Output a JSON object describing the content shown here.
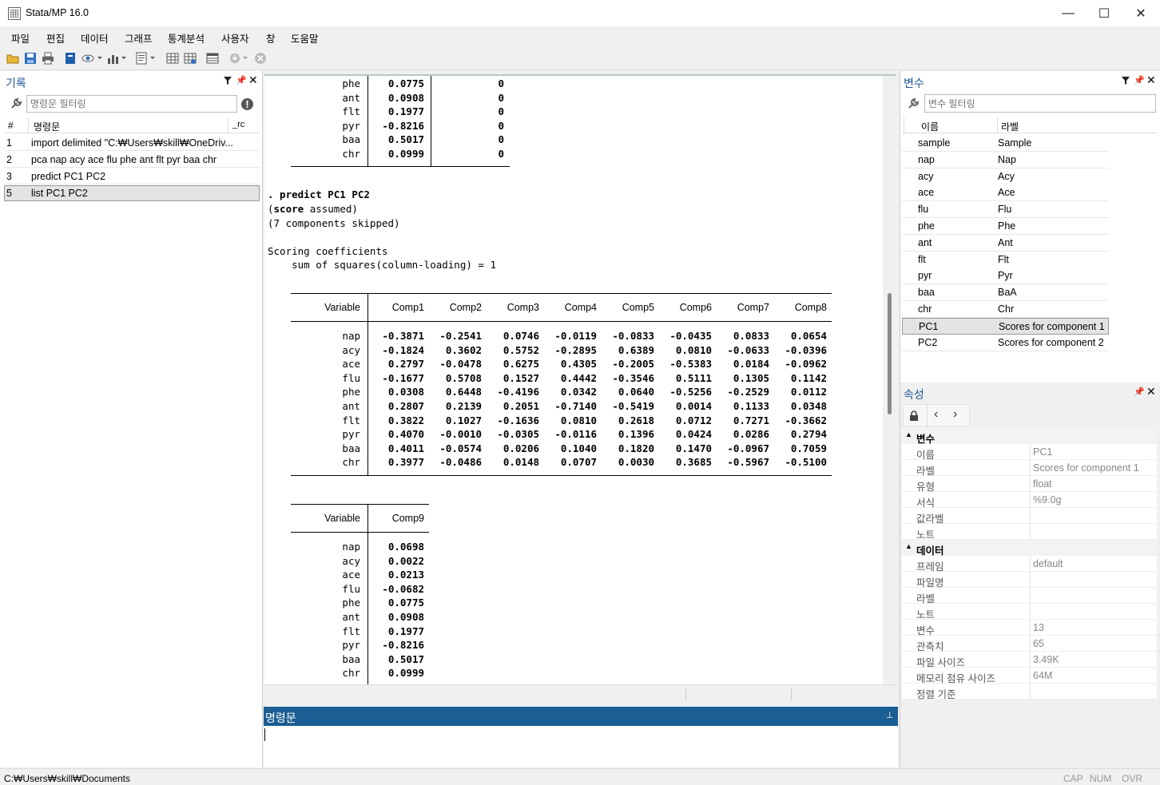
{
  "window": {
    "title": "Stata/MP 16.0",
    "minimize": "—",
    "maximize": "☐",
    "close": "✕"
  },
  "menu": [
    "파일",
    "편집",
    "데이터",
    "그래프",
    "통계분석",
    "사용자",
    "창",
    "도움말"
  ],
  "history": {
    "title": "기록",
    "filter_placeholder": "명령문 필터링",
    "col_num": "#",
    "col_cmd": "명령문",
    "col_rc": "_rc",
    "rows": [
      {
        "num": "1",
        "cmd": "import delimited \"C:₩Users₩skill₩OneDriv..."
      },
      {
        "num": "2",
        "cmd": "pca nap acy ace flu phe ant flt pyr baa chr"
      },
      {
        "num": "3",
        "cmd": "predict PC1 PC2"
      },
      {
        "num": "5",
        "cmd": "list PC1 PC2"
      }
    ]
  },
  "results": {
    "top_rows": [
      {
        "v": "phe",
        "a": "0.0775",
        "b": "0"
      },
      {
        "v": "ant",
        "a": "0.0908",
        "b": "0"
      },
      {
        "v": "flt",
        "a": "0.1977",
        "b": "0"
      },
      {
        "v": "pyr",
        "a": "-0.8216",
        "b": "0"
      },
      {
        "v": "baa",
        "a": "0.5017",
        "b": "0"
      },
      {
        "v": "chr",
        "a": "0.0999",
        "b": "0"
      }
    ],
    "cmd_line": ". predict PC1 PC2",
    "score_open": "(",
    "score_word": "score",
    "score_rest": " assumed)",
    "skipped": "(7 components skipped)",
    "scoring": "Scoring coefficients",
    "sumsq": "    sum of squares(column-loading) = 1",
    "table1_header": [
      "Variable",
      "Comp1",
      "Comp2",
      "Comp3",
      "Comp4",
      "Comp5",
      "Comp6",
      "Comp7",
      "Comp8"
    ],
    "table1_rows": [
      [
        "nap",
        "-0.3871",
        "-0.2541",
        "0.0746",
        "-0.0119",
        "-0.0833",
        "-0.0435",
        "0.0833",
        "0.0654"
      ],
      [
        "acy",
        "-0.1824",
        "0.3602",
        "0.5752",
        "-0.2895",
        "0.6389",
        "0.0810",
        "-0.0633",
        "-0.0396"
      ],
      [
        "ace",
        "0.2797",
        "-0.0478",
        "0.6275",
        "0.4305",
        "-0.2005",
        "-0.5383",
        "0.0184",
        "-0.0962"
      ],
      [
        "flu",
        "-0.1677",
        "0.5708",
        "0.1527",
        "0.4442",
        "-0.3546",
        "0.5111",
        "0.1305",
        "0.1142"
      ],
      [
        "phe",
        "0.0308",
        "0.6448",
        "-0.4196",
        "0.0342",
        "0.0640",
        "-0.5256",
        "-0.2529",
        "0.0112"
      ],
      [
        "ant",
        "0.2807",
        "0.2139",
        "0.2051",
        "-0.7140",
        "-0.5419",
        "0.0014",
        "0.1133",
        "0.0348"
      ],
      [
        "flt",
        "0.3822",
        "0.1027",
        "-0.1636",
        "0.0810",
        "0.2618",
        "0.0712",
        "0.7271",
        "-0.3662"
      ],
      [
        "pyr",
        "0.4070",
        "-0.0010",
        "-0.0305",
        "-0.0116",
        "0.1396",
        "0.0424",
        "0.0286",
        "0.2794"
      ],
      [
        "baa",
        "0.4011",
        "-0.0574",
        "0.0206",
        "0.1040",
        "0.1820",
        "0.1470",
        "-0.0967",
        "0.7059"
      ],
      [
        "chr",
        "0.3977",
        "-0.0486",
        "0.0148",
        "0.0707",
        "0.0030",
        "0.3685",
        "-0.5967",
        "-0.5100"
      ]
    ],
    "table2_header": [
      "Variable",
      "Comp9"
    ],
    "table2_rows": [
      [
        "nap",
        "0.0698"
      ],
      [
        "acy",
        "0.0022"
      ],
      [
        "ace",
        "0.0213"
      ],
      [
        "flu",
        "-0.0682"
      ],
      [
        "phe",
        "0.0775"
      ],
      [
        "ant",
        "0.0908"
      ],
      [
        "flt",
        "0.1977"
      ],
      [
        "pyr",
        "-0.8216"
      ],
      [
        "baa",
        "0.5017"
      ],
      [
        "chr",
        "0.0999"
      ]
    ]
  },
  "command": {
    "title": "명령문",
    "pin": "🖈"
  },
  "variables": {
    "title": "변수",
    "filter_placeholder": "변수 필터링",
    "col_name": "이름",
    "col_label": "라벨",
    "rows": [
      {
        "name": "sample",
        "label": "Sample"
      },
      {
        "name": "nap",
        "label": "Nap"
      },
      {
        "name": "acy",
        "label": "Acy"
      },
      {
        "name": "ace",
        "label": "Ace"
      },
      {
        "name": "flu",
        "label": "Flu"
      },
      {
        "name": "phe",
        "label": "Phe"
      },
      {
        "name": "ant",
        "label": "Ant"
      },
      {
        "name": "flt",
        "label": "Flt"
      },
      {
        "name": "pyr",
        "label": "Pyr"
      },
      {
        "name": "baa",
        "label": "BaA"
      },
      {
        "name": "chr",
        "label": "Chr"
      },
      {
        "name": "PC1",
        "label": "Scores for component 1"
      },
      {
        "name": "PC2",
        "label": "Scores for component 2"
      }
    ]
  },
  "properties": {
    "title": "속성",
    "sec_var": "변수",
    "var_props": [
      {
        "k": "이름",
        "v": "PC1"
      },
      {
        "k": "라벨",
        "v": "Scores for component 1"
      },
      {
        "k": "유형",
        "v": "float"
      },
      {
        "k": "서식",
        "v": "%9.0g"
      },
      {
        "k": "값라벨",
        "v": ""
      },
      {
        "k": "노트",
        "v": ""
      }
    ],
    "sec_data": "데이터",
    "data_props": [
      {
        "k": "프레임",
        "v": "default"
      },
      {
        "k": "파일명",
        "v": ""
      },
      {
        "k": "라벨",
        "v": ""
      },
      {
        "k": "노트",
        "v": ""
      },
      {
        "k": "변수",
        "v": "13"
      },
      {
        "k": "관측치",
        "v": "65"
      },
      {
        "k": "파일 사이즈",
        "v": "3.49K"
      },
      {
        "k": "메모리 점유 사이즈",
        "v": "64M"
      },
      {
        "k": "정렬 기준",
        "v": ""
      }
    ]
  },
  "status": {
    "path": "C:₩Users₩skill₩Documents",
    "cap": "CAP",
    "num": "NUM",
    "ovr": "OVR"
  }
}
